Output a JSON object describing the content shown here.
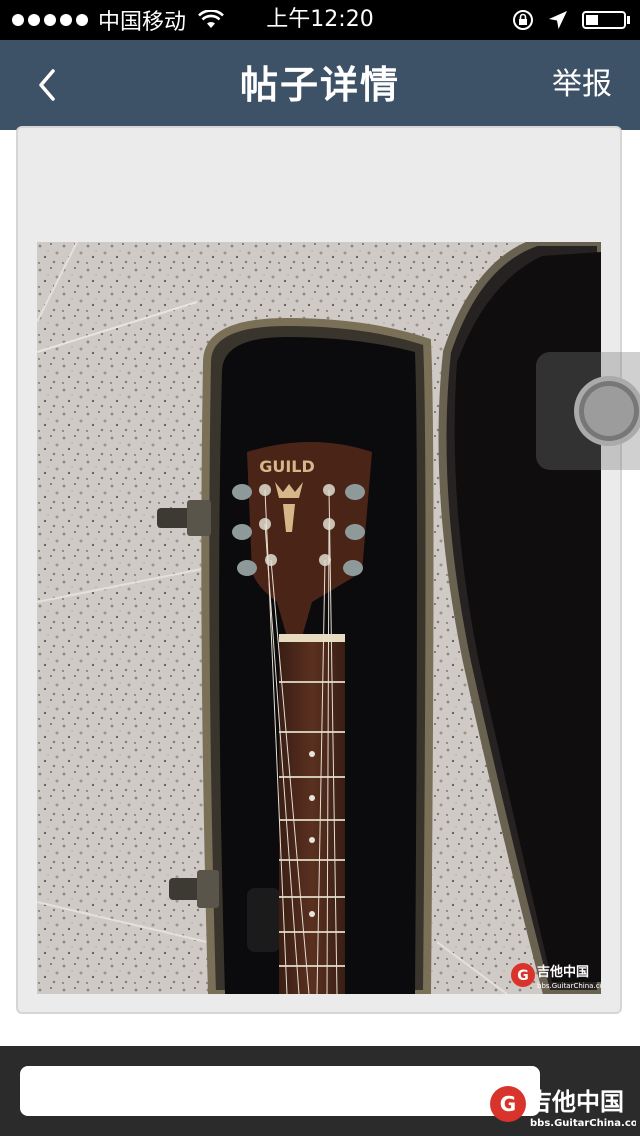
{
  "status_bar": {
    "carrier": "中国移动",
    "time": "上午12:20"
  },
  "nav": {
    "title": "帖子详情",
    "report_label": "举报",
    "back_icon": "chevron-left-icon"
  },
  "post": {
    "image": {
      "subject": "guitar-in-case-photo",
      "watermark_main": "吉他中国",
      "watermark_url": "bbs.GuitarChina.com",
      "headstock_text": "GUILD"
    }
  },
  "bottom_bar": {
    "reply_placeholder": "",
    "watermark_main": "吉他中国",
    "watermark_url": "bbs.GuitarChina.com"
  },
  "colors": {
    "nav_bg": "#3e5267",
    "status_bg": "#000000",
    "bottom_bg": "#2b2b2b",
    "card_bg": "#ebebeb"
  }
}
